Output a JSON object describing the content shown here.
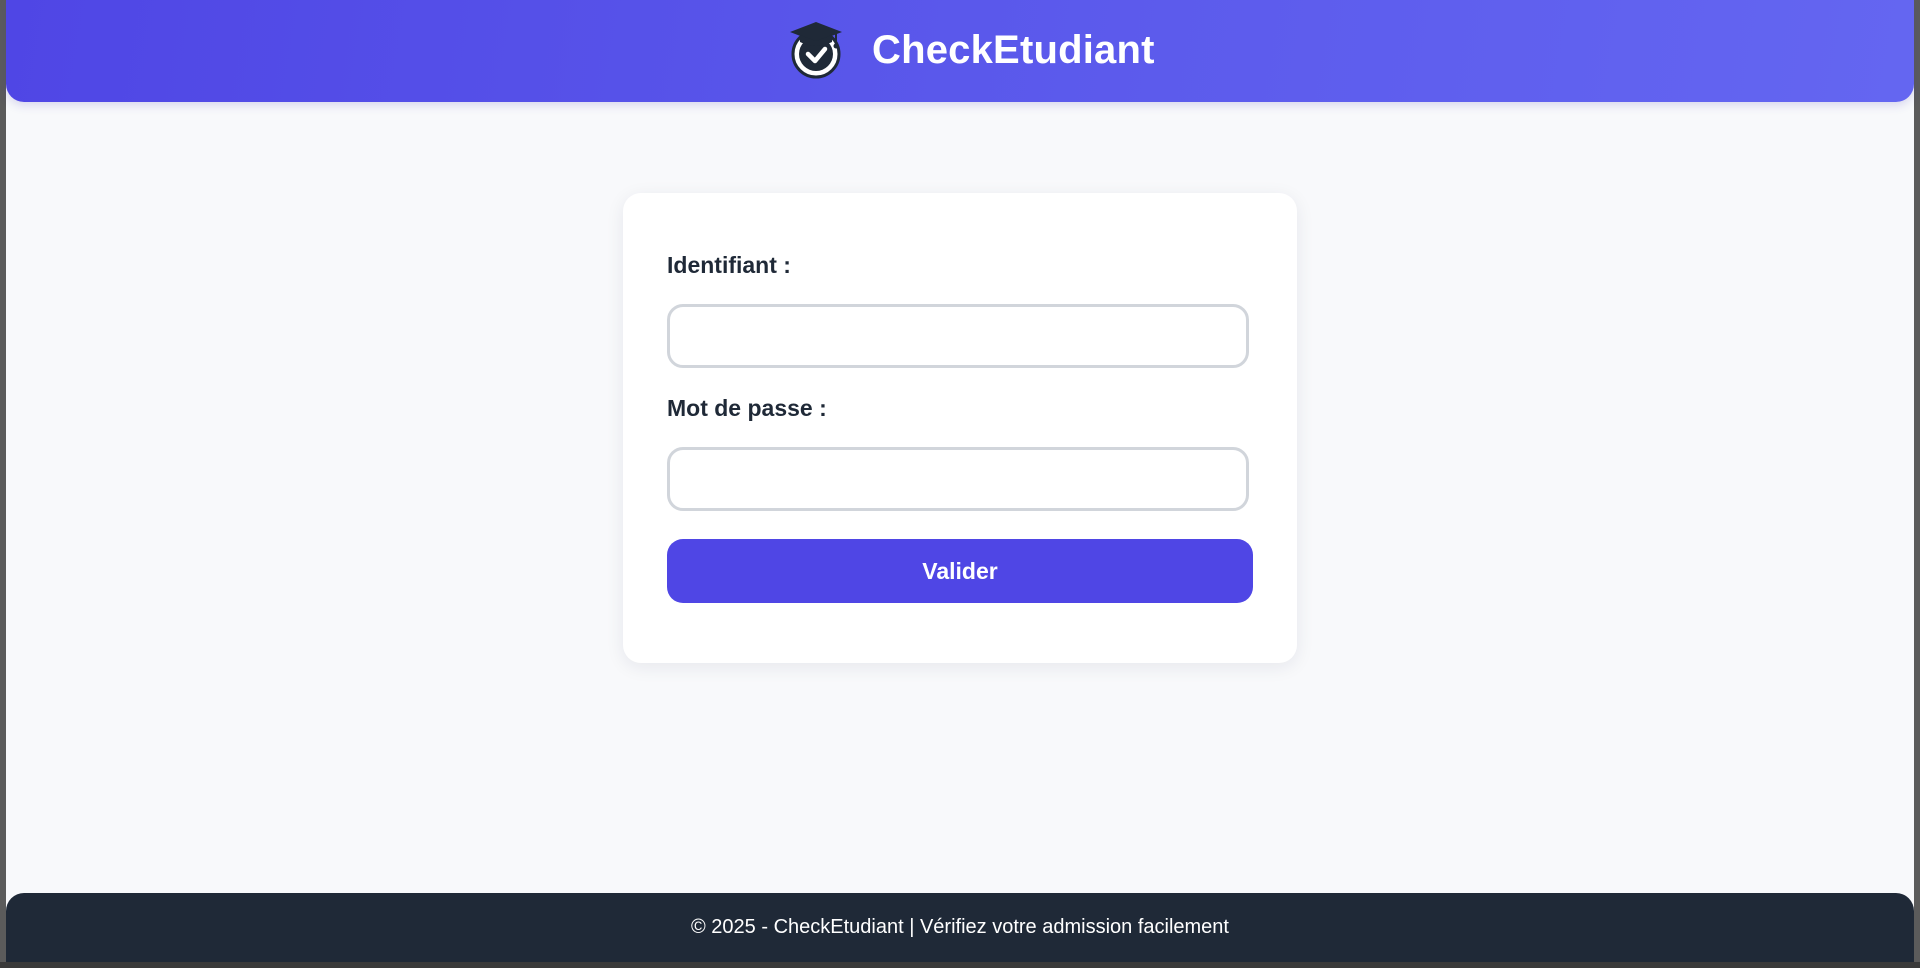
{
  "header": {
    "brand": "CheckEtudiant",
    "logo_icon": "graduate-check-icon"
  },
  "login_form": {
    "username_label": "Identifiant :",
    "username_value": "",
    "password_label": "Mot de passe :",
    "password_value": "",
    "submit_label": "Valider"
  },
  "footer": {
    "text": "© 2025 - CheckEtudiant | Vérifiez votre admission facilement"
  },
  "colors": {
    "header_gradient_start": "#4f46e5",
    "header_gradient_end": "#6466f1",
    "button": "#4f46e5",
    "footer": "#1f2937",
    "page_background": "#f8f9fb"
  }
}
